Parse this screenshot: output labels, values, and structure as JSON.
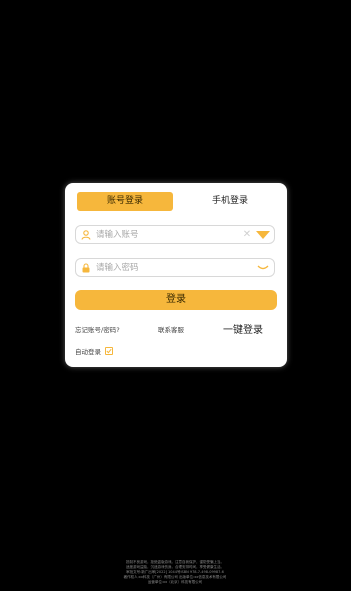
{
  "login": {
    "tabs": {
      "account": "账号登录",
      "phone": "手机登录"
    },
    "account_field": {
      "placeholder": "请输入账号",
      "value": ""
    },
    "password_field": {
      "placeholder": "请输入密码",
      "value": ""
    },
    "login_button": "登录",
    "forgot_link": "忘记账号/密码?",
    "service_link": "联系客服",
    "one_key_login": "一键登录",
    "auto_login_label": "自动登录",
    "auto_login_checked": true
  },
  "footer": {
    "lines": [
      "抵制不良游戏，拒绝盗版游戏。注意自我保护，谨防受骗上当。",
      "适度游戏益脑，沉迷游戏伤身。合理安排时间，享受健康生活。",
      "审批文号:新广出审[2022]  1044号ISBN 978-7-498-09987-6",
      "著作权人:xx科技（广州）有限公司   出版单位:xx信息技术有限公司",
      "运营单位:xx（北京）科技有限公司"
    ]
  },
  "colors": {
    "accent": "#f6b73c",
    "background": "#000000",
    "card": "#ffffff"
  },
  "icons": {
    "account": "user-icon",
    "password": "lock-icon",
    "clear": "close-icon",
    "dropdown": "caret-down-icon",
    "visibility": "eye-closed-icon",
    "checkbox": "check-icon"
  }
}
